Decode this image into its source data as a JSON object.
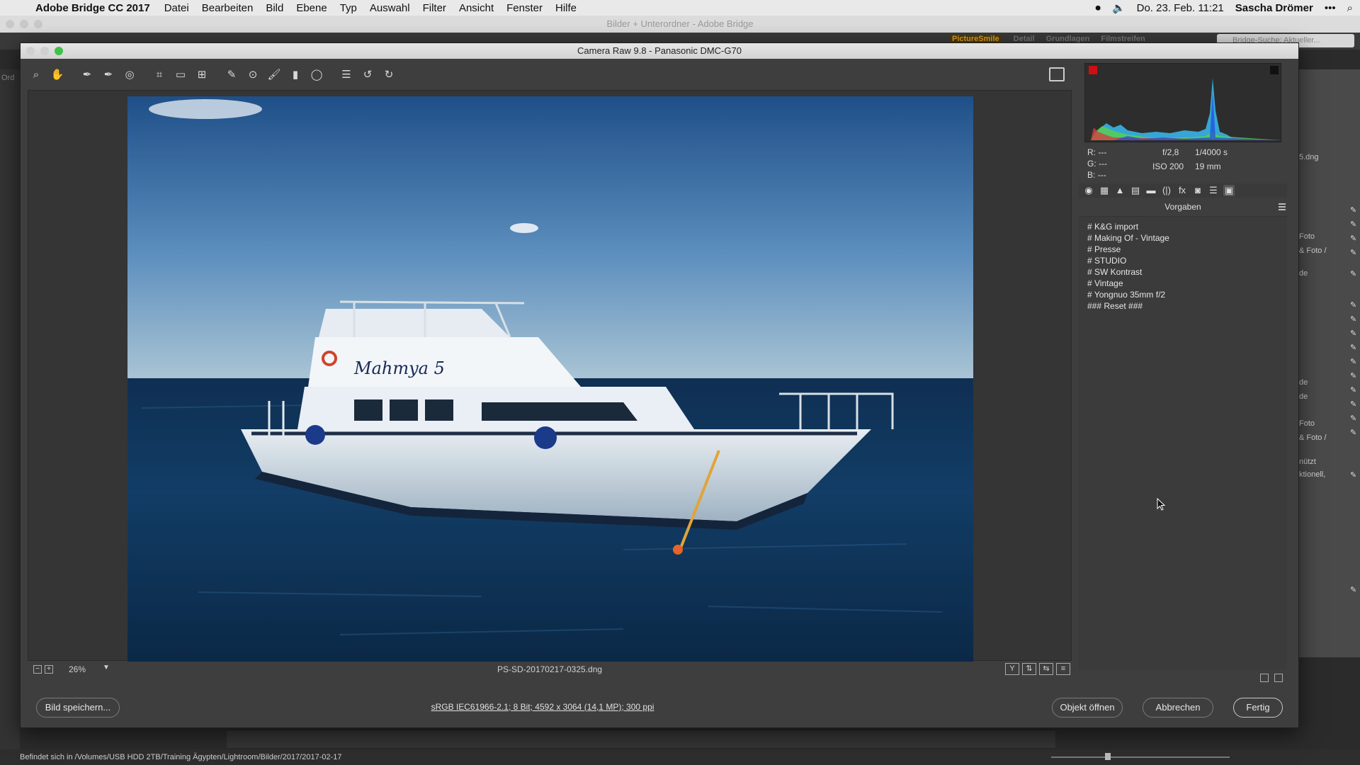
{
  "menubar": {
    "app_name": "Adobe Bridge CC 2017",
    "menus": [
      "Datei",
      "Bearbeiten",
      "Bild",
      "Ebene",
      "Typ",
      "Auswahl",
      "Filter",
      "Ansicht",
      "Fenster",
      "Hilfe"
    ],
    "clock": "Do. 23. Feb.  11:21",
    "user": "Sascha Drömer"
  },
  "bridge": {
    "window_title": "Bilder + Unterordner - Adobe Bridge",
    "workspaces": [
      "PictureSmile",
      "Detail",
      "Grundlagen",
      "Filmstreifen"
    ],
    "search_placeholder": "Bridge-Suche: Aktueller...",
    "left_label": "Ord",
    "right_items": [
      "5.dng",
      "Foto",
      "& Foto /",
      "de",
      "de",
      "de",
      "Foto",
      "& Foto /",
      "nützt",
      "ktionell,"
    ],
    "status": "Befindet sich in /Volumes/USB HDD 2TB/Training Ägypten/Lightroom/Bilder/2017/2017-02-17"
  },
  "dialog": {
    "title": "Camera Raw 9.8  -  Panasonic DMC-G70",
    "zoom": "26%",
    "filename": "PS-SD-20170217-0325.dng",
    "workflow_options": "sRGB IEC61966-2.1; 8 Bit; 4592 x 3064 (14,1 MP); 300 ppi",
    "save_label": "Bild speichern...",
    "open_label": "Objekt öffnen",
    "cancel_label": "Abbrechen",
    "done_label": "Fertig"
  },
  "readout": {
    "r": "R:   ---",
    "g": "G:   ---",
    "b": "B:   ---",
    "aperture": "f/2,8",
    "shutter": "1/4000 s",
    "iso": "ISO 200",
    "focal": "19 mm"
  },
  "presets_panel": {
    "title": "Vorgaben",
    "items": [
      "# K&G import",
      "# Making Of - Vintage",
      "# Presse",
      "# STUDIO",
      "# SW Kontrast",
      "# Vintage",
      "# Yongnuo 35mm f/2",
      "### Reset ###"
    ]
  },
  "photo": {
    "boat_name": "Mahmya 5"
  }
}
